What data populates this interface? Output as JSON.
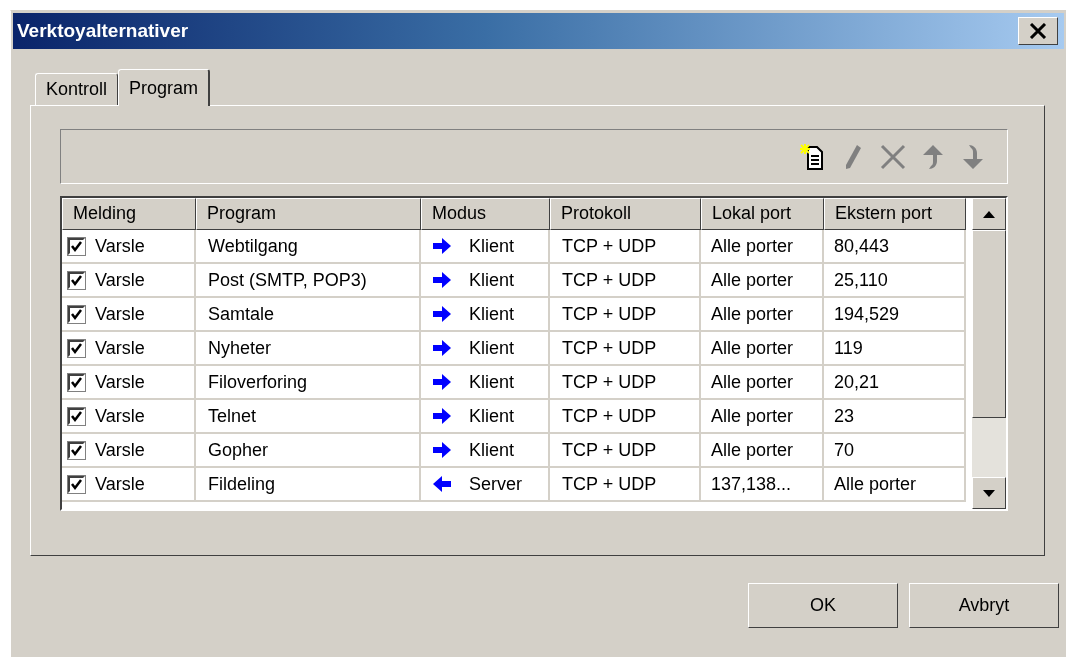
{
  "window": {
    "title": "Verktoyalternativer"
  },
  "tabs": [
    {
      "label": "Kontroll",
      "selected": false
    },
    {
      "label": "Program",
      "selected": true
    }
  ],
  "toolbar": [
    {
      "kind": "new",
      "disabled": false
    },
    {
      "kind": "edit",
      "disabled": true
    },
    {
      "kind": "delete",
      "disabled": true
    },
    {
      "kind": "up",
      "disabled": true
    },
    {
      "kind": "down",
      "disabled": true
    }
  ],
  "table": {
    "columns": [
      "Melding",
      "Program",
      "Modus",
      "Protokoll",
      "Lokal port",
      "Ekstern port"
    ],
    "rows": [
      {
        "checked": true,
        "notify": "Varsle",
        "program": "Webtilgang",
        "kind": "outgoing",
        "mode": "Klient",
        "protocol": "TCP + UDP",
        "local_port": "Alle porter",
        "remote_port": "80,443"
      },
      {
        "checked": true,
        "notify": "Varsle",
        "program": "Post (SMTP, POP3)",
        "kind": "outgoing",
        "mode": "Klient",
        "protocol": "TCP + UDP",
        "local_port": "Alle porter",
        "remote_port": "25,110"
      },
      {
        "checked": true,
        "notify": "Varsle",
        "program": "Samtale",
        "kind": "outgoing",
        "mode": "Klient",
        "protocol": "TCP + UDP",
        "local_port": "Alle porter",
        "remote_port": "194,529"
      },
      {
        "checked": true,
        "notify": "Varsle",
        "program": "Nyheter",
        "kind": "outgoing",
        "mode": "Klient",
        "protocol": "TCP + UDP",
        "local_port": "Alle porter",
        "remote_port": "119"
      },
      {
        "checked": true,
        "notify": "Varsle",
        "program": "Filoverforing",
        "kind": "outgoing",
        "mode": "Klient",
        "protocol": "TCP + UDP",
        "local_port": "Alle porter",
        "remote_port": "20,21"
      },
      {
        "checked": true,
        "notify": "Varsle",
        "program": "Telnet",
        "kind": "outgoing",
        "mode": "Klient",
        "protocol": "TCP + UDP",
        "local_port": "Alle porter",
        "remote_port": "23"
      },
      {
        "checked": true,
        "notify": "Varsle",
        "program": "Gopher",
        "kind": "outgoing",
        "mode": "Klient",
        "protocol": "TCP + UDP",
        "local_port": "Alle porter",
        "remote_port": "70"
      },
      {
        "checked": true,
        "notify": "Varsle",
        "program": "Fildeling",
        "kind": "incoming",
        "mode": "Server",
        "protocol": "TCP + UDP",
        "local_port": "137,138...",
        "remote_port": "Alle porter"
      }
    ]
  },
  "buttons": [
    {
      "label": "OK"
    },
    {
      "label": "Avbryt"
    }
  ]
}
